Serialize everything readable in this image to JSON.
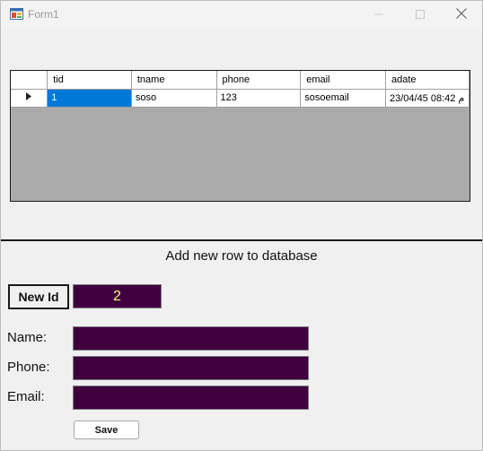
{
  "window": {
    "title": "Form1",
    "icons": {
      "app": "form-app-icon",
      "minimize": "minimize-icon",
      "maximize": "maximize-icon",
      "close": "close-icon"
    }
  },
  "grid": {
    "columns": [
      "tid",
      "tname",
      "phone",
      "email",
      "adate"
    ],
    "rows": [
      {
        "tid": "1",
        "tname": "soso",
        "phone": "123",
        "email": "sosoemail",
        "adate": "23/04/45 08:42 م"
      }
    ],
    "current_row_icon": "current-row-triangle-icon",
    "selected_color": "#0078d7",
    "background_color": "#ababab"
  },
  "form": {
    "heading": "Add new row to database",
    "new_id_label": "New Id",
    "new_id_value": "2",
    "name_label": "Name:",
    "name_value": "",
    "phone_label": "Phone:",
    "phone_value": "",
    "email_label": "Email:",
    "email_value": "",
    "save_label": "Save",
    "field_color": "#400040",
    "id_text_color": "#ffff66"
  }
}
